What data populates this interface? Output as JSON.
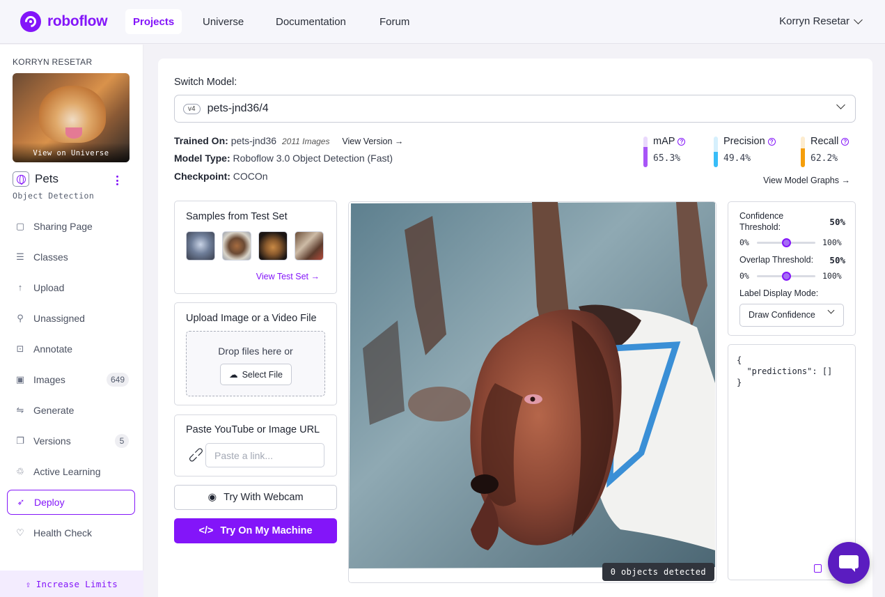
{
  "app": {
    "brand": "roboflow",
    "accent": "#8315f9"
  },
  "nav": {
    "links": [
      "Projects",
      "Universe",
      "Documentation",
      "Forum"
    ],
    "active": "Projects",
    "user": "Korryn Resetar"
  },
  "sidebar": {
    "owner": "KORRYN RESETAR",
    "thumb_caption": "View on Universe",
    "project_name": "Pets",
    "project_type": "Object Detection",
    "items": [
      {
        "label": "Sharing Page",
        "icon": "share-icon"
      },
      {
        "label": "Classes",
        "icon": "list-icon"
      },
      {
        "label": "Upload",
        "icon": "upload-icon"
      },
      {
        "label": "Unassigned",
        "icon": "search-icon"
      },
      {
        "label": "Annotate",
        "icon": "annotate-icon"
      },
      {
        "label": "Images",
        "icon": "images-icon",
        "badge": "649"
      },
      {
        "label": "Generate",
        "icon": "generate-icon"
      },
      {
        "label": "Versions",
        "icon": "versions-icon",
        "badge": "5"
      },
      {
        "label": "Active Learning",
        "icon": "recycle-icon"
      },
      {
        "label": "Deploy",
        "icon": "rocket-icon",
        "active": true
      },
      {
        "label": "Health Check",
        "icon": "heart-icon"
      }
    ],
    "increase_limits": "Increase Limits"
  },
  "main": {
    "switch_label": "Switch Model:",
    "model": {
      "version_tag": "v4",
      "name": "pets-jnd36/4"
    },
    "trained_on_label": "Trained On:",
    "trained_on_value": "pets-jnd36",
    "trained_on_images": "2011 Images",
    "view_version": "View Version",
    "model_type_label": "Model Type:",
    "model_type_value": "Roboflow 3.0 Object Detection (Fast)",
    "checkpoint_label": "Checkpoint:",
    "checkpoint_value": "COCOn",
    "metrics": [
      {
        "label": "mAP",
        "value": "65.3%",
        "fraction": 0.653,
        "color": "#a855f7",
        "track": "#ead9fd"
      },
      {
        "label": "Precision",
        "value": "49.4%",
        "fraction": 0.494,
        "color": "#38bdf8",
        "track": "#d6f0fd"
      },
      {
        "label": "Recall",
        "value": "62.2%",
        "fraction": 0.622,
        "color": "#f59e0b",
        "track": "#fdeccf"
      }
    ],
    "view_graphs": "View Model Graphs",
    "samples_title": "Samples from Test Set",
    "view_test_set": "View Test Set",
    "upload_title": "Upload Image or a Video File",
    "drop_text": "Drop files here or",
    "select_file": "Select File",
    "paste_title": "Paste YouTube or Image URL",
    "paste_placeholder": "Paste a link...",
    "webcam": "Try With Webcam",
    "try_machine": "Try On My Machine",
    "objects_detected": "0 objects detected",
    "settings": {
      "confidence_label": "Confidence Threshold:",
      "confidence_value": "50%",
      "confidence_fraction": 0.5,
      "overlap_label": "Overlap Threshold:",
      "overlap_value": "50%",
      "overlap_fraction": 0.5,
      "min": "0%",
      "max": "100%",
      "label_mode_label": "Label Display Mode:",
      "label_mode_value": "Draw Confidence"
    },
    "json_output": "{\n  \"predictions\": []\n}"
  }
}
